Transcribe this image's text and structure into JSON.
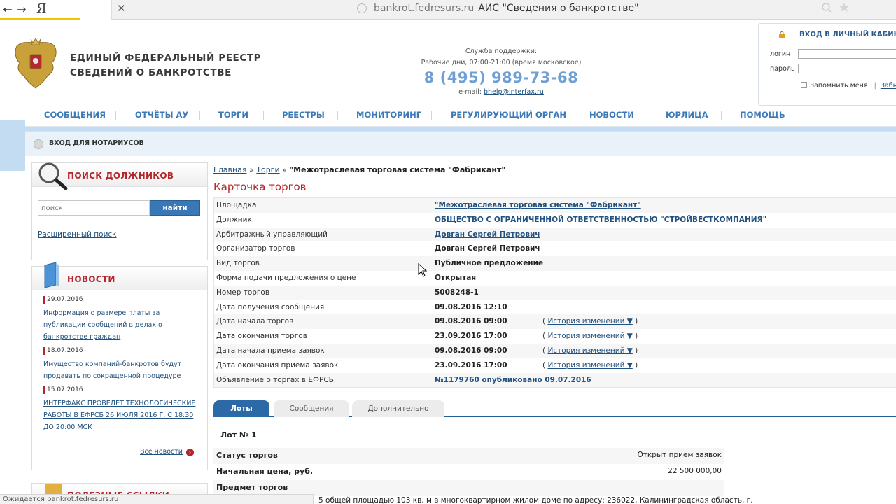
{
  "browser": {
    "url": "bankrot.fedresurs.ru",
    "title": "АИС \"Сведения о банкротстве\"",
    "back_glyph": "←",
    "forward_glyph": "→",
    "yandex_glyph": "Я",
    "close_glyph": "✕",
    "status": "Ожидается bankrot.fedresurs.ru"
  },
  "header": {
    "logo_line1": "ЕДИНЫЙ ФЕДЕРАЛЬНЫЙ РЕЕСТР",
    "logo_line2": "СВЕДЕНИЙ О БАНКРОТСТВЕ",
    "support_label": "Служба поддержки:",
    "support_hours": "Рабочие дни, 07:00-21:00 (время московское)",
    "support_phone": "8 (495) 989-73-68",
    "support_email_label": "e-mail:",
    "support_email": "bhelp@interfax.ru"
  },
  "login": {
    "title": "ВХОД В ЛИЧНЫЙ КАБИНЕТ",
    "login_label": "логин",
    "password_label": "пароль",
    "remember_label": "Запомнить меня",
    "separator": "|",
    "forgot_label": "Забыли пароль?"
  },
  "menu": {
    "items": [
      "СООБЩЕНИЯ",
      "ОТЧЁТЫ АУ",
      "ТОРГИ",
      "РЕЕСТРЫ",
      "МОНИТОРИНГ",
      "РЕГУЛИРУЮЩИЙ ОРГАН",
      "НОВОСТИ",
      "ЮРЛИЦА",
      "ПОМОЩЬ"
    ]
  },
  "notary": {
    "label": "ВХОД ДЛЯ НОТАРИУСОВ"
  },
  "search_widget": {
    "title": "ПОИСК ДОЛЖНИКОВ",
    "placeholder": "поиск",
    "button": "найти",
    "advanced_link": "Расширенный поиск"
  },
  "news_widget": {
    "title": "НОВОСТИ",
    "items": [
      {
        "date": "29.07.2016",
        "text": "Информация о размере платы за публикации сообщений в делах о банкротстве граждан"
      },
      {
        "date": "18.07.2016",
        "text": "Имущество компаний-банкротов будут продавать по сокращенной процедуре"
      },
      {
        "date": "15.07.2016",
        "text": "ИНТЕРФАКС ПРОВЕДЕТ ТЕХНОЛОГИЧЕСКИЕ РАБОТЫ В ЕФРСБ 26 ИЮЛЯ 2016 Г. С 18:30 ДО 20:00 МСК"
      }
    ],
    "all_news": "Все новости",
    "all_news_glyph": "›"
  },
  "bottom_widget": {
    "title": "ПОЛЕЗНЫЕ ССЫЛКИ"
  },
  "breadcrumb": {
    "home": "Главная",
    "sep": "»",
    "section": "Торги",
    "current": "\"Межотраслевая торговая система \"Фабрикант\""
  },
  "card": {
    "title": "Карточка торгов",
    "rows": [
      {
        "label": "Площадка",
        "value": "\"Межотраслевая торговая система \"Фабрикант\"",
        "style": "link",
        "history": false
      },
      {
        "label": "Должник",
        "value": "ОБЩЕСТВО С ОГРАНИЧЕННОЙ ОТВЕТСТВЕННОСТЬЮ \"СТРОЙВЕСТКОМПАНИЯ\"",
        "style": "link",
        "history": false
      },
      {
        "label": "Арбитражный управляющий",
        "value": "Довган Сергей Петрович",
        "style": "link",
        "history": false
      },
      {
        "label": "Организатор торгов",
        "value": "Довган Сергей Петрович",
        "style": "plain",
        "history": false
      },
      {
        "label": "Вид торгов",
        "value": "Публичное предложение",
        "style": "plain",
        "history": false
      },
      {
        "label": "Форма подачи предложения о цене",
        "value": "Открытая",
        "style": "plain",
        "history": false
      },
      {
        "label": "Номер торгов",
        "value": "5008248-1",
        "style": "plain",
        "history": false
      },
      {
        "label": "Дата получения сообщения",
        "value": "09.08.2016 12:10",
        "style": "plain",
        "history": false
      },
      {
        "label": "Дата начала торгов",
        "value": "09.08.2016 09:00",
        "style": "plain",
        "history": true
      },
      {
        "label": "Дата окончания торгов",
        "value": "23.09.2016 17:00",
        "style": "plain",
        "history": true
      },
      {
        "label": "Дата начала приема заявок",
        "value": "09.08.2016 09:00",
        "style": "plain",
        "history": true
      },
      {
        "label": "Дата окончания приема заявок",
        "value": "23.09.2016 17:00",
        "style": "plain",
        "history": true
      },
      {
        "label": "Объявление о торгах в ЕФРСБ",
        "value": "№1179760 опубликовано 09.07.2016",
        "style": "blue",
        "history": false
      }
    ],
    "history_open": "(",
    "history_link": "История изменений ▼",
    "history_close": ")"
  },
  "tabs": [
    {
      "label": "Лоты",
      "active": true
    },
    {
      "label": "Сообщения",
      "active": false
    },
    {
      "label": "Дополнительно",
      "active": false
    }
  ],
  "lot": {
    "title": "Лот № 1",
    "rows": [
      {
        "label": "Статус торгов",
        "value": "Открыт прием заявок"
      },
      {
        "label": "Начальная цена, руб.",
        "value": "22 500 000,00"
      },
      {
        "label": "Предмет торгов",
        "value": ""
      }
    ],
    "description": "5 общей площадью 103 кв. м в многоквартирном жилом доме по адресу: 236022, Калининградская область, г."
  },
  "colors": {
    "accent_blue": "#3b79b9",
    "title_red": "#b3262b",
    "link_blue": "#21517f",
    "phone_blue": "#6fa0d4",
    "tab_active": "#2b6aa6"
  }
}
